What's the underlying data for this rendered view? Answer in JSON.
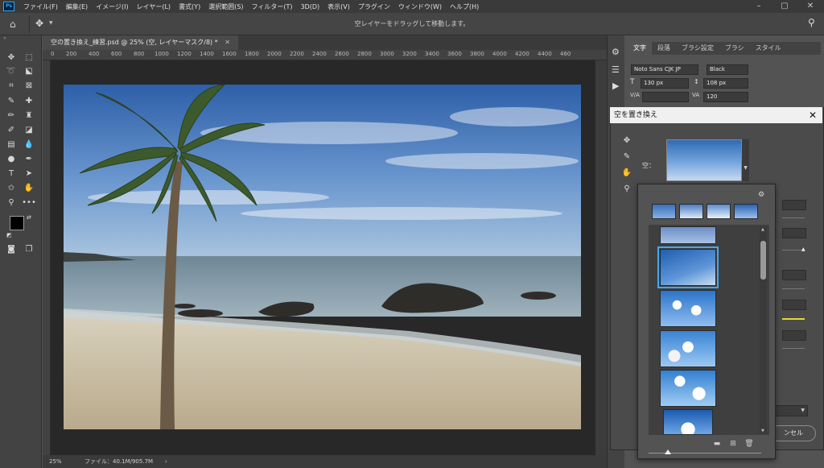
{
  "app": {
    "logo": "Ps"
  },
  "menu": [
    "ファイル(F)",
    "編集(E)",
    "イメージ(I)",
    "レイヤー(L)",
    "書式(Y)",
    "選択範囲(S)",
    "フィルター(T)",
    "3D(D)",
    "表示(V)",
    "プラグイン",
    "ウィンドウ(W)",
    "ヘルプ(H)"
  ],
  "options_bar": {
    "hint": "空レイヤーをドラッグして移動します。"
  },
  "document": {
    "tab_title": "空の置き換え_練習.psd @ 25% (空, レイヤーマスク/8) *",
    "zoom": "25%",
    "file_info": "ファイル：40.1M/905.7M",
    "ruler_labels": [
      "0",
      "200",
      "400",
      "600",
      "800",
      "1000",
      "1200",
      "1400",
      "1600",
      "1800",
      "2000",
      "2200",
      "2400",
      "2600",
      "2800",
      "3000",
      "3200",
      "3400",
      "3600",
      "3800",
      "4000",
      "4200",
      "4400",
      "460"
    ]
  },
  "character_panel": {
    "tabs": [
      "文字",
      "段落",
      "ブラシ設定",
      "ブラシ",
      "スタイル"
    ],
    "font_family": "Noto Sans CJK JP",
    "font_weight": "Black",
    "size": "130 px",
    "leading": "108 px",
    "tracking": "120"
  },
  "sky_dialog": {
    "title": "空を置き換え",
    "sky_label": "空：",
    "cancel": "ンセル"
  }
}
